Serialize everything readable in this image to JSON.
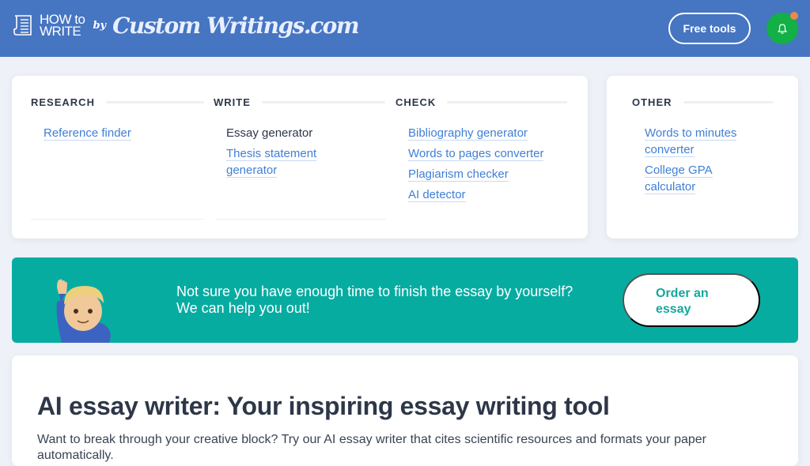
{
  "header": {
    "logo_howto_line1": "HOW to",
    "logo_howto_line2": "WRITE",
    "logo_by": "by",
    "logo_brand": "Custom Writings.com",
    "free_tools_label": "Free tools",
    "bell_icon": "bell-icon",
    "colors": {
      "bar": "#4675c2",
      "bell_bg": "#12b045",
      "notification_dot": "#e98a4a"
    }
  },
  "tools": {
    "columns": [
      {
        "heading": "RESEARCH",
        "items": [
          {
            "label": "Reference finder",
            "link": true
          }
        ]
      },
      {
        "heading": "WRITE",
        "items": [
          {
            "label": "Essay generator",
            "link": false
          },
          {
            "label": "Thesis statement generator",
            "link": true
          }
        ]
      },
      {
        "heading": "CHECK",
        "items": [
          {
            "label": "Bibliography generator",
            "link": true
          },
          {
            "label": "Words to pages converter",
            "link": true
          },
          {
            "label": "Plagiarism checker",
            "link": true
          },
          {
            "label": "AI detector",
            "link": true
          }
        ]
      }
    ],
    "other": {
      "heading": "OTHER",
      "items": [
        {
          "label": "Words to minutes converter",
          "link": true
        },
        {
          "label": "College GPA calculator",
          "link": true
        }
      ]
    },
    "link_color": "#3f7fd6"
  },
  "banner": {
    "line1": "Not sure you have enough time to finish the essay by yourself?",
    "line2": "We can help you out!",
    "button_label": "Order an essay",
    "avatar_icon": "waving-person-icon",
    "color": "#07aca1"
  },
  "main": {
    "title": "AI essay writer: Your inspiring essay writing tool",
    "description": "Want to break through your creative block? Try our AI essay writer that cites scientific resources and formats your paper automatically."
  }
}
